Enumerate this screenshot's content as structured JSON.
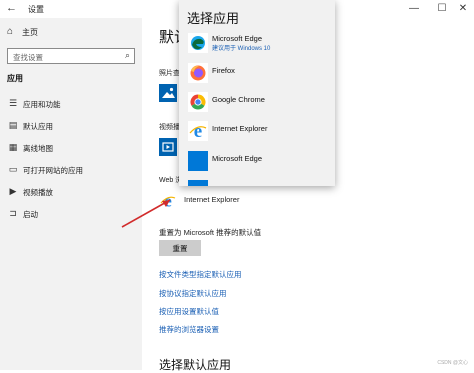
{
  "window": {
    "title": "设置",
    "back_icon": "back-arrow-icon",
    "minimize_glyph": "—",
    "maximize_glyph": "☐",
    "close_glyph": "✕"
  },
  "sidebar": {
    "home_label": "主页",
    "search_placeholder": "查找设置",
    "section_title": "应用",
    "items": [
      {
        "label": "应用和功能",
        "icon": "apps-list-icon"
      },
      {
        "label": "默认应用",
        "icon": "default-apps-icon"
      },
      {
        "label": "离线地图",
        "icon": "offline-maps-icon"
      },
      {
        "label": "可打开网站的应用",
        "icon": "apps-for-websites-icon"
      },
      {
        "label": "视频播放",
        "icon": "video-playback-icon"
      },
      {
        "label": "启动",
        "icon": "startup-icon"
      }
    ]
  },
  "main": {
    "title_partial": "默认",
    "categories": [
      {
        "label": "照片查"
      },
      {
        "label": "视频播"
      },
      {
        "label": "Web 浏"
      }
    ],
    "web_browser_app": "Internet Explorer",
    "reset_text": "重置为 Microsoft 推荐的默认值",
    "reset_button": "重置",
    "links": [
      "按文件类型指定默认应用",
      "按协议指定默认应用",
      "按应用设置默认值",
      "推荐的浏览器设置"
    ],
    "bottom_title": "选择默认应用"
  },
  "popup": {
    "title": "选择应用",
    "items": [
      {
        "name": "Microsoft Edge",
        "sub": "建议用于 Windows 10",
        "icon": "edge-icon"
      },
      {
        "name": "Firefox",
        "sub": "",
        "icon": "firefox-icon"
      },
      {
        "name": "Google Chrome",
        "sub": "",
        "icon": "chrome-icon"
      },
      {
        "name": "Internet Explorer",
        "sub": "",
        "icon": "internet-explorer-icon"
      },
      {
        "name": "Microsoft Edge",
        "sub": "",
        "icon": "edge-legacy-icon"
      }
    ]
  },
  "colors": {
    "accent": "#0063b1",
    "link": "#1a5fb4",
    "annotation_arrow": "#d12b2b"
  },
  "watermark": "CSDN @文心"
}
